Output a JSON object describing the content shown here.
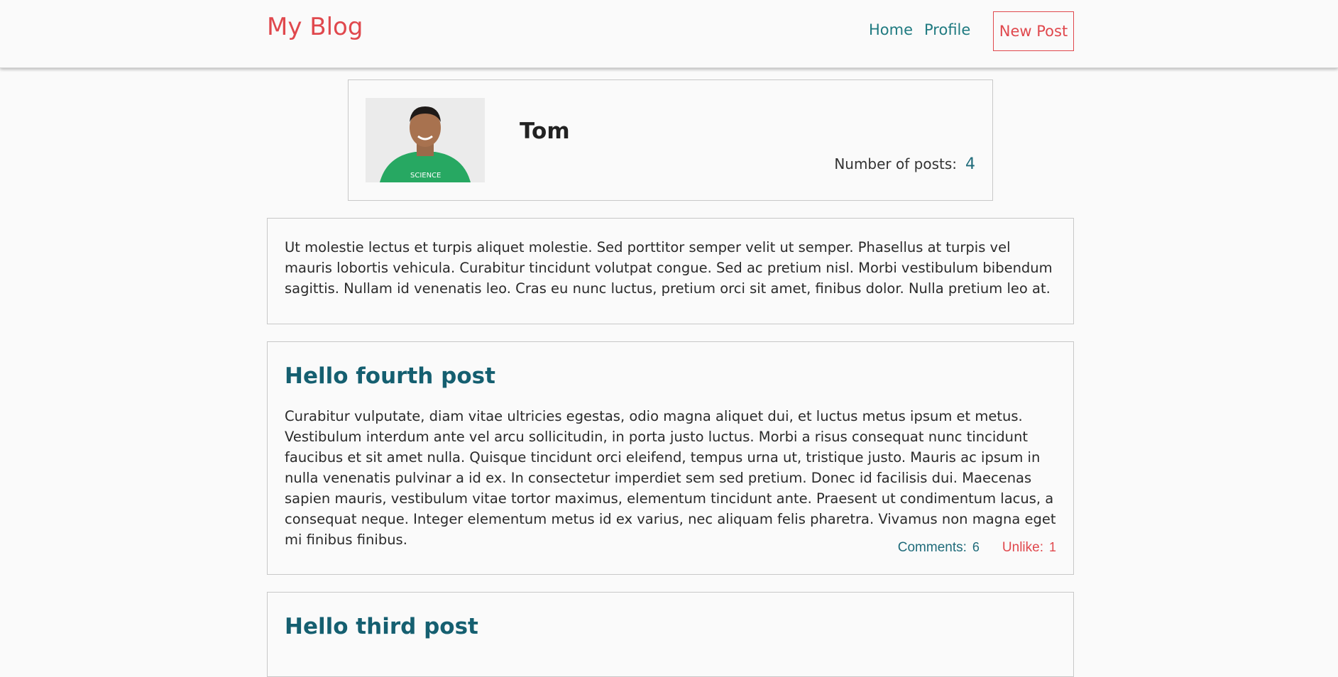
{
  "navbar": {
    "brand": "My Blog",
    "links": [
      {
        "label": "Home"
      },
      {
        "label": "Profile"
      }
    ],
    "new_post_label": "New Post"
  },
  "profile": {
    "name": "Tom",
    "posts_label": "Number of posts:",
    "posts_count": "4"
  },
  "bio": {
    "text": "Ut molestie lectus et turpis aliquet molestie. Sed porttitor semper velit ut semper. Phasellus at turpis vel mauris lobortis vehicula. Curabitur tincidunt volutpat congue. Sed ac pretium nisl. Morbi vestibulum bibendum sagittis. Nullam id venenatis leo. Cras eu nunc luctus, pretium orci sit amet, finibus dolor. Nulla pretium leo at."
  },
  "posts": [
    {
      "title": "Hello fourth post",
      "body": "Curabitur vulputate, diam vitae ultricies egestas, odio magna aliquet dui, et luctus metus ipsum et metus. Vestibulum interdum ante vel arcu sollicitudin, in porta justo luctus. Morbi a risus consequat nunc tincidunt faucibus et sit amet nulla. Quisque tincidunt orci eleifend, tempus urna ut, tristique justo. Mauris ac ipsum in nulla venenatis pulvinar a id ex. In consectetur imperdiet sem sed pretium. Donec id facilisis dui. Maecenas sapien mauris, vestibulum vitae tortor maximus, elementum tincidunt ante. Praesent ut condimentum lacus, a consequat neque. Integer elementum metus id ex varius, nec aliquam felis pharetra. Vivamus non magna eget mi finibus finibus.",
      "comments_label": "Comments:",
      "comments_count": "6",
      "unlike_label": "Unlike:",
      "unlike_count": "1"
    },
    {
      "title": "Hello third post"
    }
  ],
  "colors": {
    "brand": "#e0484d",
    "link": "#1f7a80",
    "title": "#155f70"
  }
}
